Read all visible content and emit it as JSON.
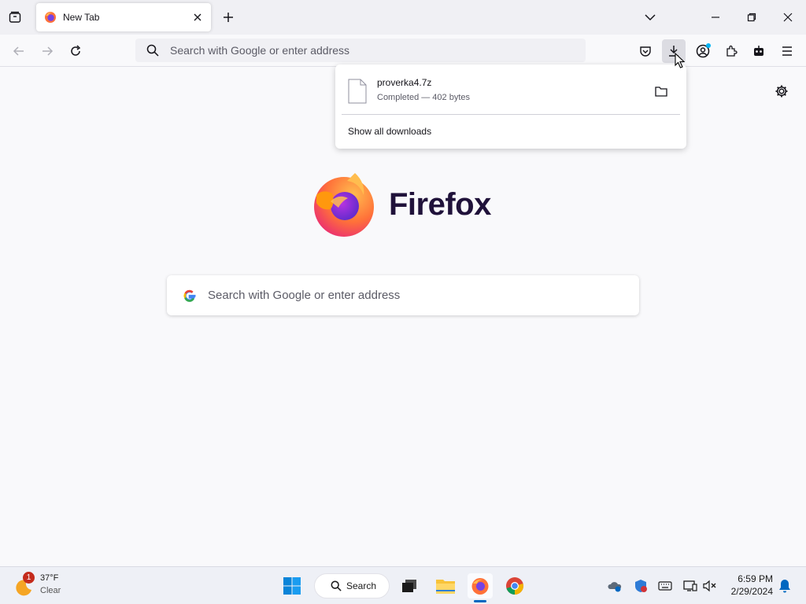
{
  "tab": {
    "title": "New Tab"
  },
  "urlbar": {
    "placeholder": "Search with Google or enter address"
  },
  "downloads_panel": {
    "items": [
      {
        "name": "proverka4.7z",
        "status": "Completed — 402 bytes"
      }
    ],
    "show_all_label": "Show all downloads"
  },
  "newtab": {
    "brand": "Firefox",
    "search_placeholder": "Search with Google or enter address"
  },
  "taskbar": {
    "weather": {
      "badge": "1",
      "temp": "37°F",
      "condition": "Clear"
    },
    "search_label": "Search",
    "clock": {
      "time": "6:59 PM",
      "date": "2/29/2024"
    }
  },
  "colors": {
    "accent": "#0067c0",
    "firefox_orange": "#ff7139",
    "firefox_purple": "#7542e5",
    "account_dot": "#00b3f4"
  }
}
